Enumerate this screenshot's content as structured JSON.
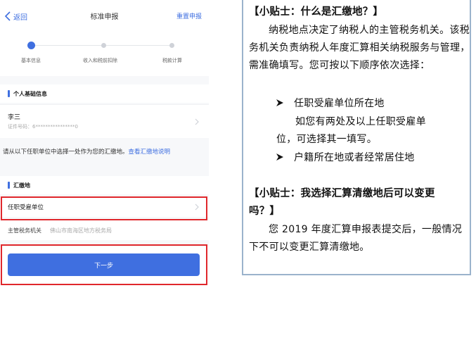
{
  "phone": {
    "nav": {
      "back_label": "返回",
      "title": "标准申报",
      "reset_label": "重置申报"
    },
    "steps": [
      {
        "label": "基本信息"
      },
      {
        "label": "收入和税前扣除"
      },
      {
        "label": "税款计算"
      }
    ],
    "personal_section": {
      "title": "个人基础信息"
    },
    "person": {
      "name": "李三",
      "id_text": "证件号码：6****************0"
    },
    "notice": {
      "text": "请从以下任职单位中选择一处作为您的汇缴地。",
      "link": "查看汇缴地说明"
    },
    "remit_section": {
      "title": "汇缴地"
    },
    "employer_row": {
      "label": "任职受雇单位"
    },
    "tax_authority": {
      "label": "主管税务机关",
      "value": "佛山市南海区地方税务局"
    },
    "next_button": {
      "label": "下一步"
    }
  },
  "tips": {
    "tip1_title": "【小贴士：什么是汇缴地？】",
    "tip1_body": "纳税地点决定了纳税人的主管税务机关。该税务机关负责纳税人年度汇算相关纳税服务与管理，需准确填写。您可按以下顺序依次选择：",
    "option1": "任职受雇单位所在地",
    "option1_note_line1": "如您有两处及以上任职受雇单",
    "option1_note_line2": "位，可选择其一填写。",
    "option2": "户籍所在地或者经常居住地",
    "tip2_title_line1": "【小贴士：我选择汇算清缴地后可以变更",
    "tip2_title_line2": "吗？】",
    "tip2_body": "您 2019 年度汇算申报表提交后，一般情况下不可以变更汇算清缴地。"
  },
  "colors": {
    "accent": "#3f6fe0",
    "highlight": "#e0272c",
    "tip_border": "#9bb3cc"
  }
}
